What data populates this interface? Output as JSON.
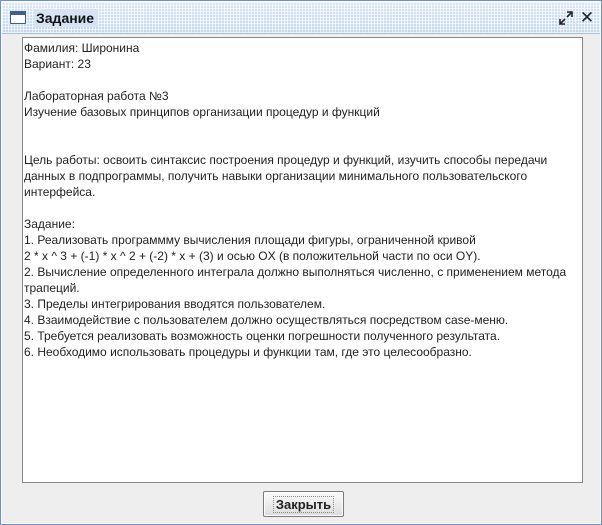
{
  "window": {
    "title": "Задание"
  },
  "content": {
    "lines": [
      "Фамилия: Широнина",
      "Вариант: 23",
      "",
      "Лабораторная работа №3",
      "Изучение базовых принципов организации процедур и функций",
      "",
      "",
      "Цель работы: освоить синтаксис построения процедур и функций, изучить способы передачи",
      "данных в подпрограммы, получить навыки организации минимального пользовательского",
      "интерфейса.",
      "",
      "Задание:",
      "1. Реализовать программму вычисления площади фигуры, ограниченной кривой",
      "2 * x ^ 3 + (-1) * x ^ 2 + (-2) * x + (3) и осью OX (в положительной части по оси OY).",
      "2. Вычисление определенного интеграла должно выполняться численно, с применением метода",
      "трапеций.",
      "3. Пределы интегрирования вводятся пользователем.",
      "4. Взаимодействие с пользователем должно осуществляться посредством case-меню.",
      "5. Требуется реализовать возможность оценки погрешности полученного результата.",
      "6. Необходимо использовать процедуры и функции там, где это целесообразно."
    ]
  },
  "footer": {
    "close_label": "Закрыть"
  },
  "icons": {
    "app": "window-icon",
    "restore": "restore-icon",
    "close": "close-icon"
  },
  "colors": {
    "desktop": "#2f64c8",
    "titlebar": "#c9dbf2",
    "window_bg": "#eeeeee"
  }
}
